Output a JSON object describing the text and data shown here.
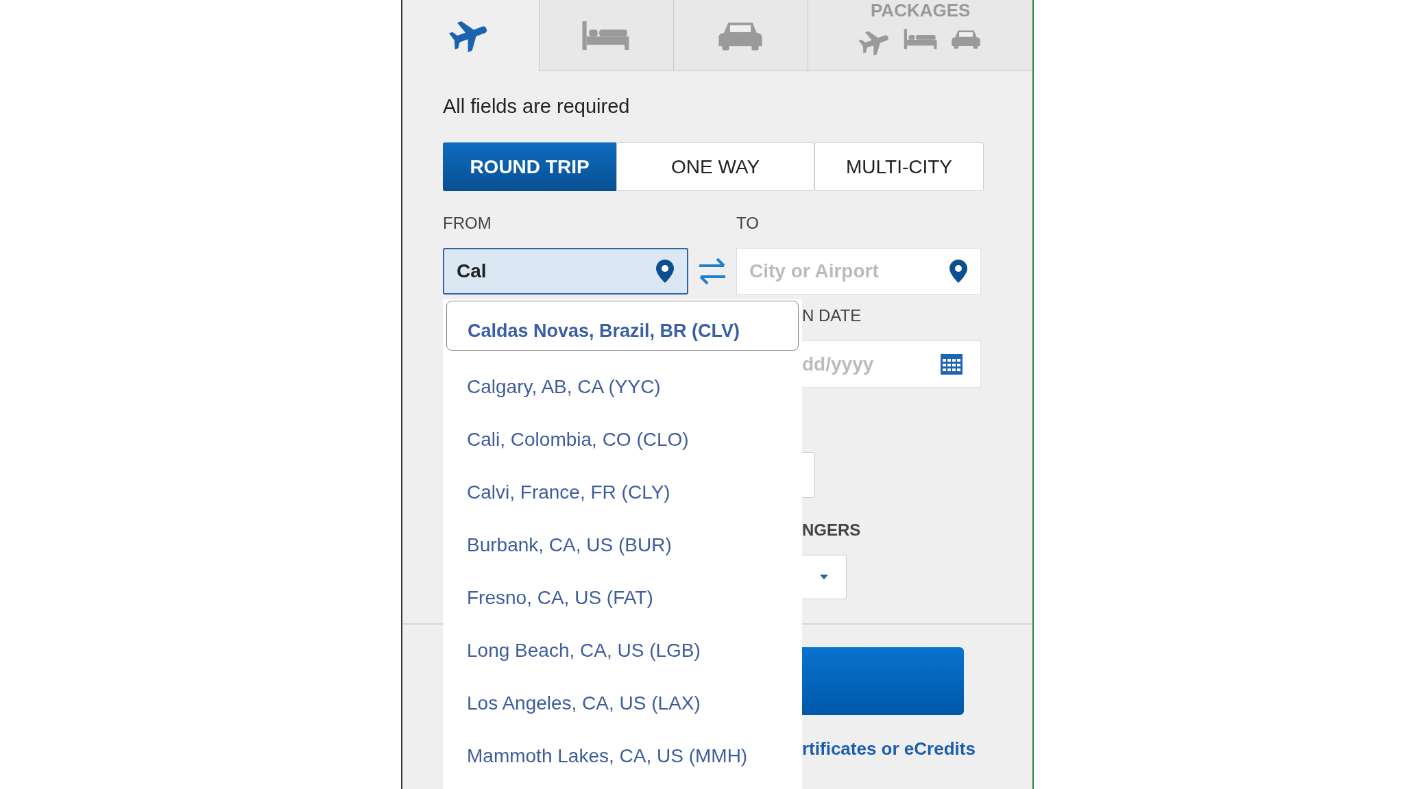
{
  "tabs": [
    {
      "kind": "flight",
      "selected": true
    },
    {
      "kind": "hotel",
      "selected": false
    },
    {
      "kind": "car",
      "selected": false
    },
    {
      "kind": "package",
      "label": "PACKAGES",
      "selected": false
    }
  ],
  "required_note": "All fields are required",
  "trip_types": [
    {
      "label": "ROUND TRIP",
      "selected": true
    },
    {
      "label": "ONE WAY",
      "selected": false
    },
    {
      "label": "MULTI-CITY",
      "selected": false
    }
  ],
  "from": {
    "label": "FROM",
    "value": "Cal"
  },
  "to": {
    "label": "TO",
    "placeholder": "City or Airport"
  },
  "suggestions": [
    {
      "label": "Caldas Novas, Brazil, BR (CLV)",
      "selected": true
    },
    {
      "label": "Calgary, AB, CA (YYC)",
      "selected": false
    },
    {
      "label": "Cali, Colombia, CO (CLO)",
      "selected": false
    },
    {
      "label": "Calvi, France, FR (CLY)",
      "selected": false
    },
    {
      "label": "Burbank, CA, US (BUR)",
      "selected": false
    },
    {
      "label": "Fresno, CA, US (FAT)",
      "selected": false
    },
    {
      "label": "Long Beach, CA, US (LGB)",
      "selected": false
    },
    {
      "label": "Los Angeles, CA, US (LAX)",
      "selected": false
    },
    {
      "label": "Mammoth Lakes, CA, US (MMH)",
      "selected": false
    }
  ],
  "date": {
    "label": "N DATE",
    "placeholder": "dd/yyyy"
  },
  "passengers": {
    "label": "NGERS"
  },
  "link": "rtificates or eCredits"
}
